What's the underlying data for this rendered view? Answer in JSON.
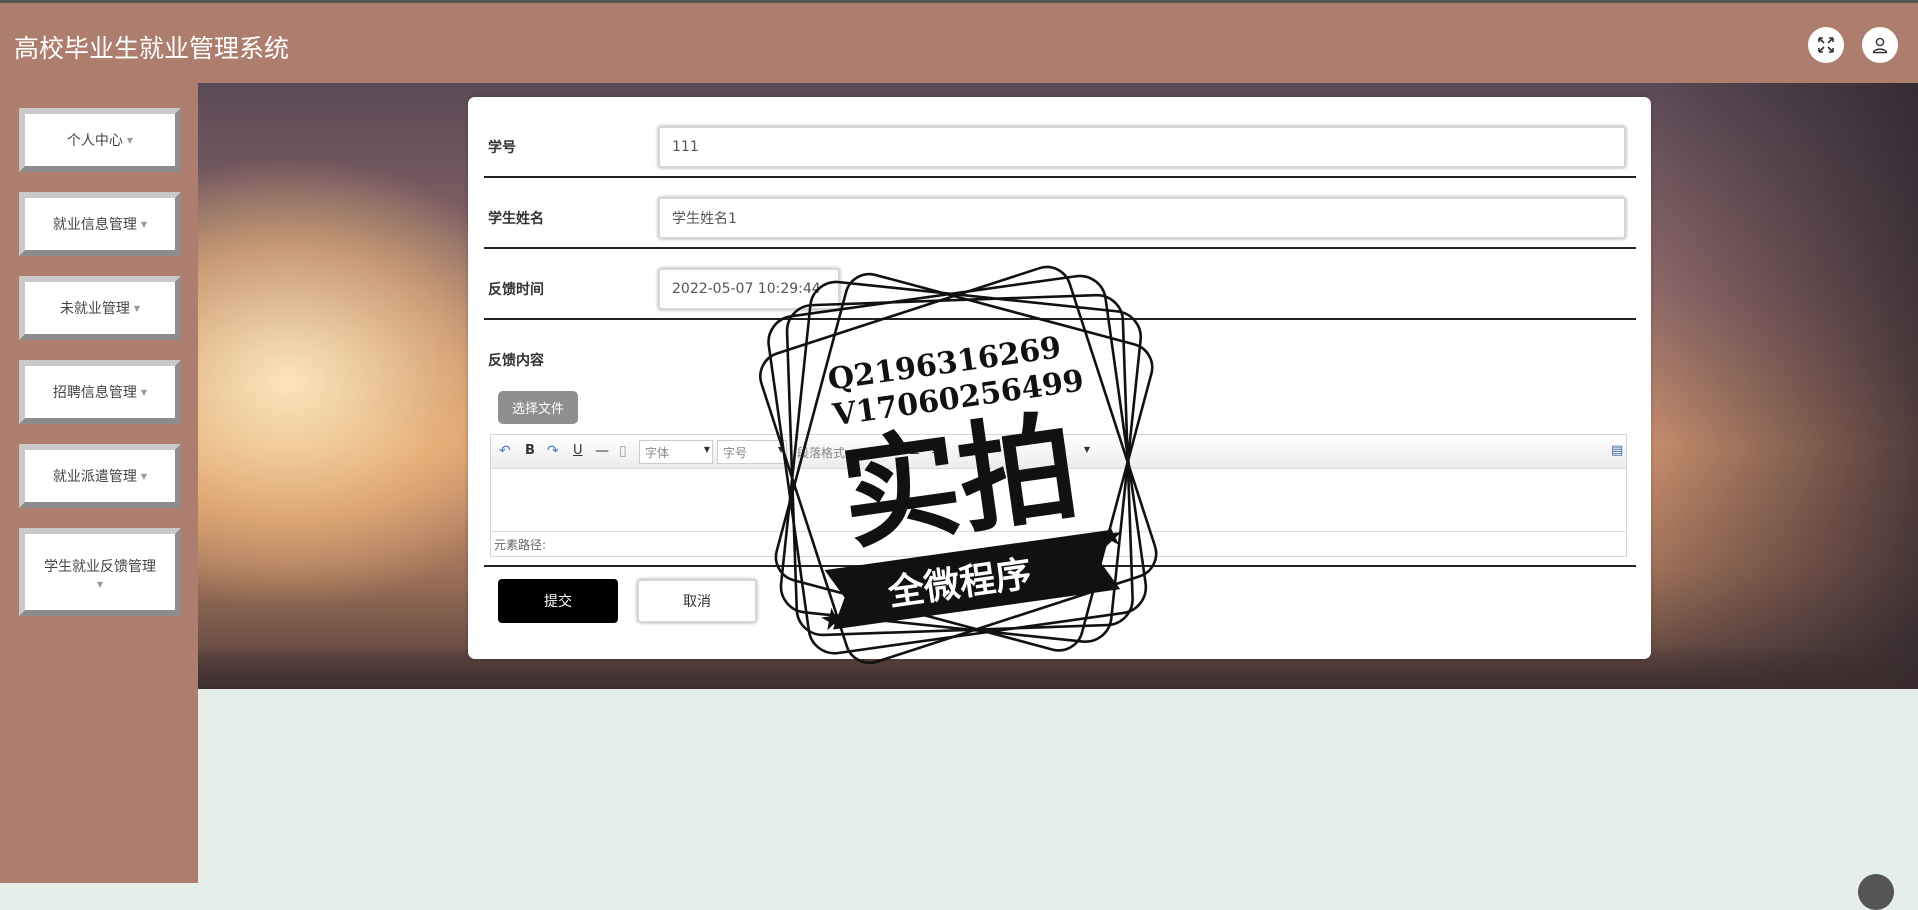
{
  "app": {
    "title": "高校毕业生就业管理系统"
  },
  "header": {
    "fullscreen_icon": "expand-icon",
    "user_icon": "user-icon"
  },
  "sidebar": {
    "items": [
      {
        "label": "个人中心"
      },
      {
        "label": "就业信息管理"
      },
      {
        "label": "未就业管理"
      },
      {
        "label": "招聘信息管理"
      },
      {
        "label": "就业派遣管理"
      },
      {
        "label": "学生就业反馈管理"
      }
    ]
  },
  "form": {
    "student_id": {
      "label": "学号",
      "value": "111"
    },
    "student_name": {
      "label": "学生姓名",
      "value": "学生姓名1"
    },
    "feedback_time": {
      "label": "反馈时间",
      "value": "2022-05-07 10:29:44"
    },
    "feedback_content": {
      "label": "反馈内容"
    },
    "upload_label": "选择文件",
    "submit_label": "提交",
    "cancel_label": "取消"
  },
  "editor": {
    "font_family_placeholder": "字体",
    "font_size_placeholder": "字号",
    "paragraph_placeholder": "段落格式",
    "path_label": "元素路径:"
  },
  "watermark": {
    "line1": "Q2196316269",
    "line2": "V17060256499",
    "main": "实拍",
    "ribbon": "全微程序"
  }
}
